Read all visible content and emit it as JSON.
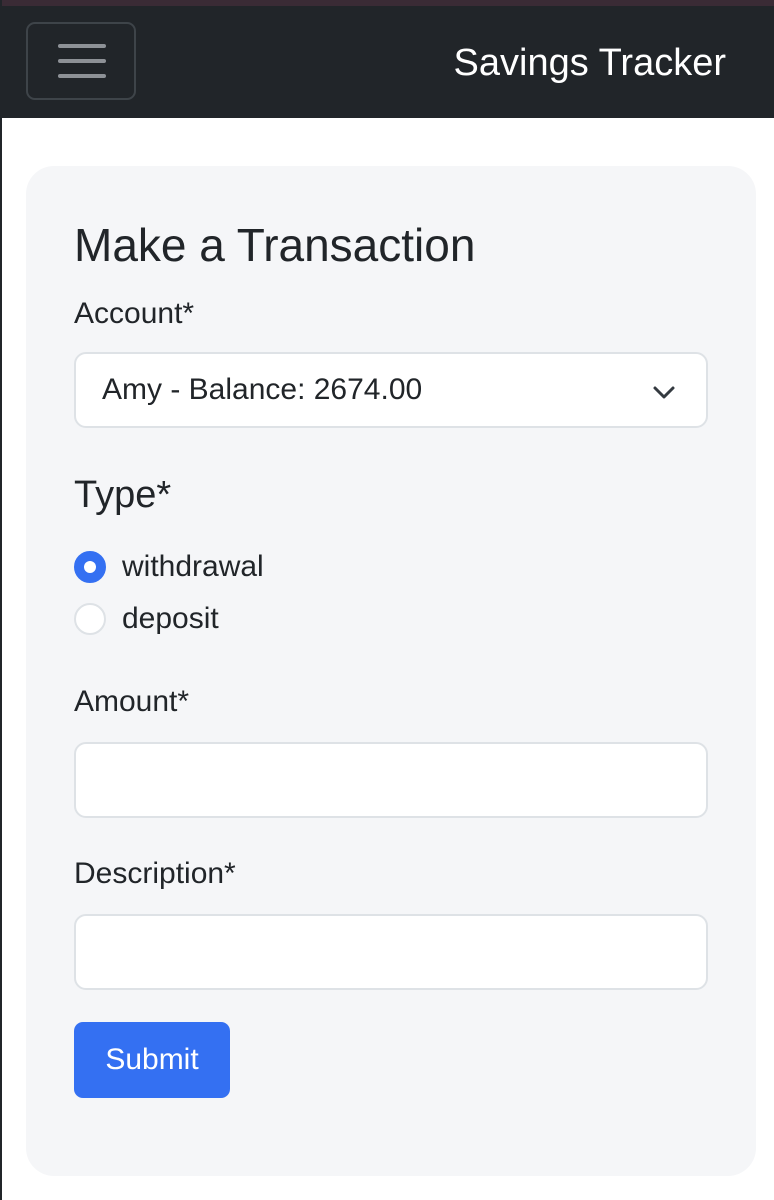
{
  "navbar": {
    "brand": "Savings Tracker",
    "toggle_icon": "hamburger-icon"
  },
  "form": {
    "title": "Make a Transaction",
    "account": {
      "label": "Account*",
      "selected": "Amy - Balance: 2674.00",
      "icon": "chevron-down-icon"
    },
    "type": {
      "label": "Type*",
      "options": [
        {
          "label": "withdrawal",
          "checked": true
        },
        {
          "label": "deposit",
          "checked": false
        }
      ]
    },
    "amount": {
      "label": "Amount*",
      "value": ""
    },
    "description": {
      "label": "Description*",
      "value": ""
    },
    "submit_label": "Submit"
  },
  "colors": {
    "navbar_bg": "#212529",
    "card_bg": "#f5f6f8",
    "primary": "#3470f2"
  }
}
